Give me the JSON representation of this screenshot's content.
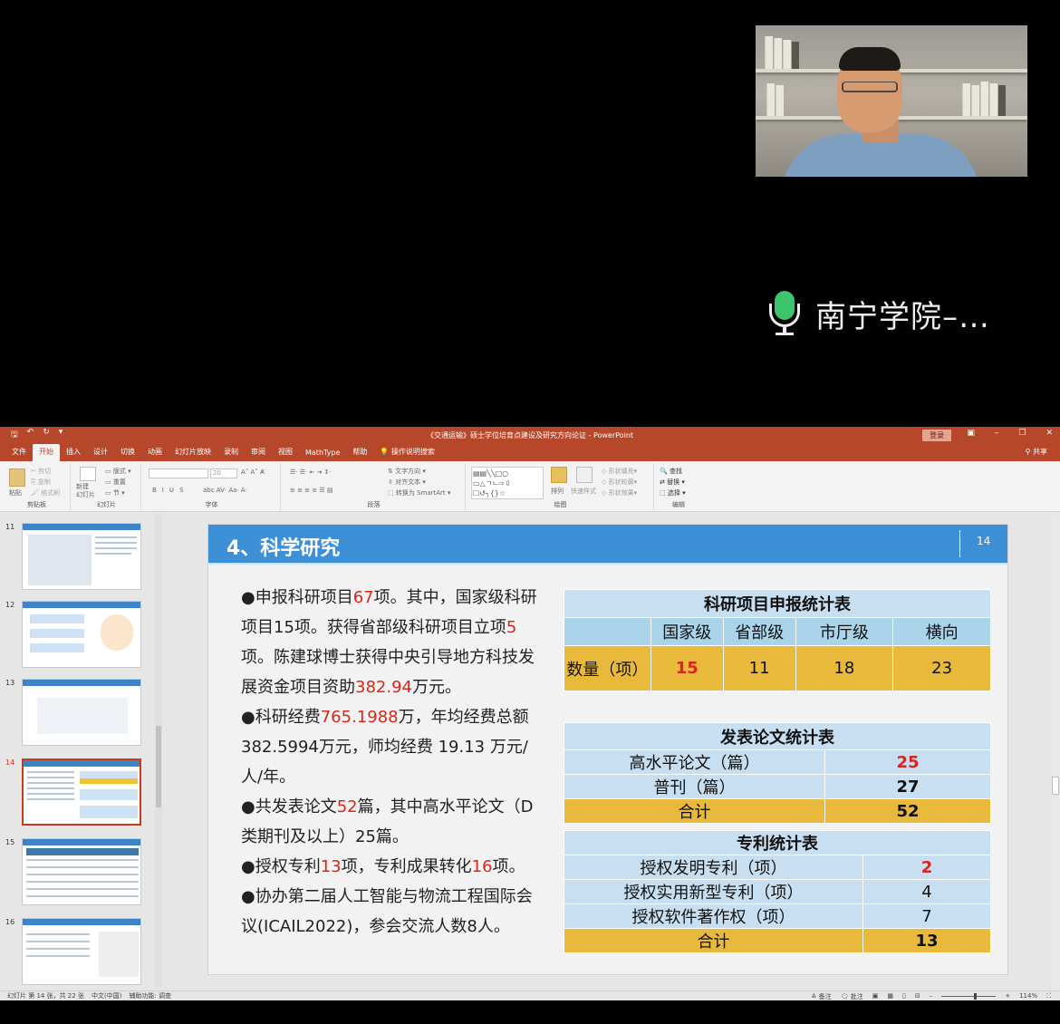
{
  "call": {
    "speaker_name": "南宁学院–…"
  },
  "window": {
    "title": "《交通运输》硕士学位培育点建设及研究方向论证  -  PowerPoint",
    "login_label": "登录",
    "share_label": "共享",
    "accent_color": "#b7472a"
  },
  "ribbon": {
    "tabs": [
      "文件",
      "开始",
      "插入",
      "设计",
      "切换",
      "动画",
      "幻灯片放映",
      "录制",
      "审阅",
      "视图",
      "MathType",
      "帮助"
    ],
    "tell_me": "操作说明搜索",
    "groups": {
      "clipboard": "剪贴板",
      "slides": "幻灯片",
      "font": "字体",
      "paragraph": "段落",
      "drawing": "绘图",
      "editing": "编辑"
    },
    "buttons": {
      "paste": "粘贴",
      "cut": "剪切",
      "copy": "复制",
      "format_painter": "格式刷",
      "new_slide": "新建\n幻灯片",
      "layout": "版式",
      "reset": "重置",
      "section": "节",
      "text_direction": "文字方向",
      "align_text": "对齐文本",
      "smartart": "转换为 SmartArt",
      "arrange": "排列",
      "quick_styles": "快速样式",
      "shape_fill": "形状填充",
      "shape_outline": "形状轮廓",
      "shape_effects": "形状效果",
      "find": "查找",
      "replace": "替换",
      "select": "选择"
    },
    "font_size": "20"
  },
  "thumbnails": {
    "numbers": [
      "11",
      "12",
      "13",
      "14",
      "15",
      "16"
    ],
    "active": "14"
  },
  "slide": {
    "title": "4、科学研究",
    "page": "14",
    "bullets": [
      {
        "pre": "●申报科研项目",
        "hl": "67",
        "post": "项。其中，国家级科研项目15项。获得省部级科研项目立项"
      },
      {
        "pre": "",
        "hl": "5",
        "post": "项。陈建球博士获得中央引导地方科技发展资金项目资助"
      },
      {
        "pre": "",
        "hl": "382.94",
        "post": "万元。"
      },
      {
        "pre": "●科研经费",
        "hl": "765.1988",
        "post": "万，年均经费总额382.5994万元，师均经费 19.13 万元/人/年。"
      },
      {
        "pre": "●共发表论文",
        "hl": "52",
        "post": "篇，其中高水平论文（D类期刊及以上）25篇。"
      },
      {
        "pre": "●授权专利",
        "hl": "13",
        "post": "项，专利成果转化"
      },
      {
        "pre": "",
        "hl": "16",
        "post": "项。"
      },
      {
        "pre": "●协办第二届人工智能与物流工程国际会议(ICAIL2022)，参会交流人数8人。",
        "hl": "",
        "post": ""
      }
    ],
    "project_table": {
      "caption": "科研项目申报统计表",
      "headers": [
        "",
        "国家级",
        "省部级",
        "市厅级",
        "横向"
      ],
      "row_label": "数量（项）",
      "values": [
        "15",
        "11",
        "18",
        "23"
      ]
    },
    "paper_table": {
      "caption": "发表论文统计表",
      "rows": [
        {
          "label": "高水平论文（篇）",
          "value": "25"
        },
        {
          "label": "普刊（篇）",
          "value": "27"
        },
        {
          "label": "合计",
          "value": "52"
        }
      ]
    },
    "patent_table": {
      "caption": "专利统计表",
      "rows": [
        {
          "label": "授权发明专利（项）",
          "value": "2"
        },
        {
          "label": "授权实用新型专利（项）",
          "value": "4"
        },
        {
          "label": "授权软件著作权（项）",
          "value": "7"
        },
        {
          "label": "合计",
          "value": "13"
        }
      ]
    },
    "colors": {
      "header_blue": "#3d8fd6",
      "table_light": "#c7dff1",
      "table_mid": "#a9d4ea",
      "table_yellow": "#e9b93b",
      "highlight_red": "#d9261c"
    }
  },
  "status": {
    "slide_info": "幻灯片 第 14 张，共 22 张",
    "language": "中文(中国)",
    "accessibility": "辅助功能: 调查",
    "notes": "备注",
    "comments": "批注",
    "zoom": "114%"
  }
}
